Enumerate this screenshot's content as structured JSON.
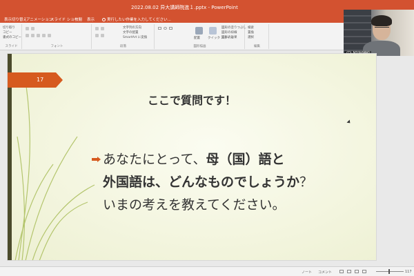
{
  "window": {
    "title": "2022.08.02 异大講師院進１.pptx - PowerPoint"
  },
  "ribbon": {
    "tabs": [
      "表示切り替え",
      "アニメーション",
      "スライド ショー",
      "校閲",
      "表示"
    ],
    "search_label": "実行したい作業を入力してください...",
    "clipboard": {
      "items": [
        "切り取り",
        "コピー",
        "書式のコピー"
      ],
      "label": "スライド"
    },
    "font": {
      "label": "フォント"
    },
    "paragraph": {
      "items": [
        "文字列の方向",
        "文字の配置",
        "SmartArt に変換"
      ],
      "label": "段落"
    },
    "drawing": {
      "arrange_label": "配置",
      "styles_label": "クイック スタイル",
      "items": [
        "図形の塗りつぶし",
        "図形の枠線",
        "図形の効果"
      ],
      "label": "図形描画"
    },
    "editing": {
      "items": [
        "検索",
        "置換",
        "選択"
      ],
      "label": "編集"
    }
  },
  "webcam": {
    "name": "(D) MIYAWAKI"
  },
  "slide": {
    "page_number": "17",
    "title": "ここで質問です！",
    "line1_normal": "あなたにとって、",
    "line1_bold": "母（国）語と",
    "line2_bold": "外国語は、どんなものでしょうか",
    "line2_end": "？",
    "line3": "いまの考えを教えてください。",
    "accent_color": "#d65a1f"
  },
  "statusbar": {
    "notes_label": "ノート",
    "comments_label": "コメント",
    "zoom": "117"
  }
}
